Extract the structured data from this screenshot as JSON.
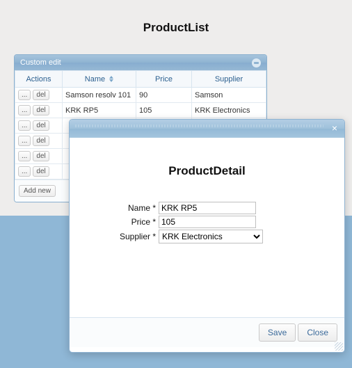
{
  "page": {
    "title": "ProductList"
  },
  "panel": {
    "title": "Custom edit",
    "columns": {
      "actions": "Actions",
      "name": "Name",
      "price": "Price",
      "supplier": "Supplier"
    },
    "btn_edit": "...",
    "btn_del": "del",
    "btn_add": "Add new",
    "rows": [
      {
        "name": "Samson resolv 101",
        "price": "90",
        "supplier": "Samson"
      },
      {
        "name": "KRK RP5",
        "price": "105",
        "supplier": "KRK Electronics"
      },
      {
        "name": "",
        "price": "",
        "supplier": ""
      },
      {
        "name": "",
        "price": "",
        "supplier": ""
      },
      {
        "name": "",
        "price": "",
        "supplier": ""
      },
      {
        "name": "",
        "price": "",
        "supplier": ""
      }
    ]
  },
  "dialog": {
    "title": "ProductDetail",
    "labels": {
      "name": "Name *",
      "price": "Price *",
      "supplier": "Supplier *"
    },
    "values": {
      "name": "KRK RP5",
      "price": "105",
      "supplier": "KRK Electronics"
    },
    "buttons": {
      "save": "Save",
      "close": "Close"
    }
  }
}
